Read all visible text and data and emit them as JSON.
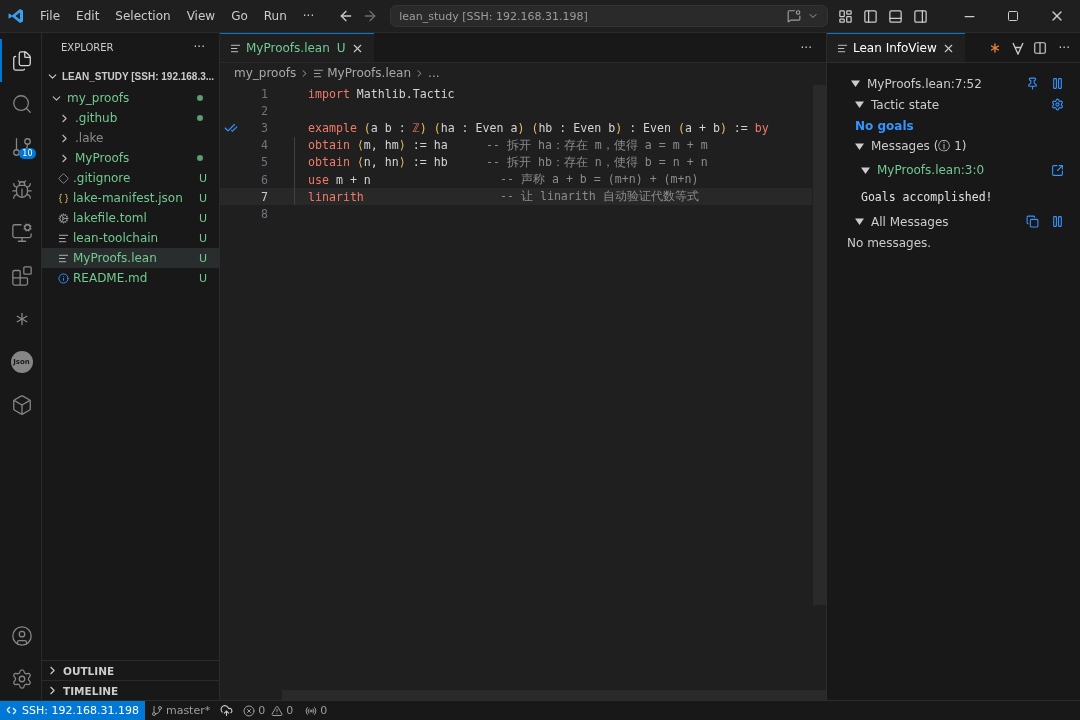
{
  "title_bar": {
    "menu": [
      "File",
      "Edit",
      "Selection",
      "View",
      "Go",
      "Run",
      "···"
    ],
    "search": "lean_study [SSH: 192.168.31.198]"
  },
  "activity_bar": {
    "items": [
      {
        "kind": "explorer",
        "selected": true
      },
      {
        "kind": "search",
        "selected": false
      },
      {
        "kind": "scm",
        "selected": false,
        "badge": "10"
      },
      {
        "kind": "run",
        "selected": false
      },
      {
        "kind": "remote",
        "selected": false
      },
      {
        "kind": "extensions",
        "selected": false
      },
      {
        "kind": "lean",
        "selected": false
      },
      {
        "kind": "json",
        "selected": false,
        "label": "Json"
      },
      {
        "kind": "package",
        "selected": false
      }
    ],
    "bottom": [
      {
        "kind": "account",
        "selected": false
      },
      {
        "kind": "settings",
        "selected": false
      }
    ]
  },
  "sidebar": {
    "title": "EXPLORER",
    "more": "···",
    "root": {
      "label": "LEAN_STUDY [SSH: 192.168.3...",
      "expanded": true
    },
    "tree": [
      {
        "name": "my_proofs",
        "kind": "folder",
        "expanded": true,
        "dot": true,
        "ignored": false,
        "selected": false,
        "children": [
          {
            "name": ".github",
            "kind": "folder",
            "expanded": false,
            "dot": true,
            "ignored": false,
            "selected": false
          },
          {
            "name": ".lake",
            "kind": "folder",
            "expanded": false,
            "dot": false,
            "ignored": true,
            "selected": false
          },
          {
            "name": "MyProofs",
            "kind": "folder",
            "expanded": false,
            "dot": true,
            "ignored": false,
            "selected": false
          },
          {
            "name": ".gitignore",
            "kind": "git",
            "badge": "U",
            "ignored": false,
            "selected": false
          },
          {
            "name": "lake-manifest.json",
            "kind": "json",
            "badge": "U",
            "ignored": false,
            "selected": false
          },
          {
            "name": "lakefile.toml",
            "kind": "toml",
            "badge": "U",
            "ignored": false,
            "selected": false
          },
          {
            "name": "lean-toolchain",
            "kind": "text",
            "badge": "U",
            "ignored": false,
            "selected": false
          },
          {
            "name": "MyProofs.lean",
            "kind": "text",
            "badge": "U",
            "ignored": false,
            "selected": true
          },
          {
            "name": "README.md",
            "kind": "info",
            "badge": "U",
            "ignored": false,
            "selected": false
          }
        ]
      }
    ],
    "sections": [
      {
        "label": "OUTLINE",
        "expanded": false
      },
      {
        "label": "TIMELINE",
        "expanded": false
      }
    ]
  },
  "editor": {
    "tab": {
      "label": "MyProofs.lean",
      "badge": "U",
      "selected": true
    },
    "more": "···",
    "breadcrumbs": [
      "my_proofs",
      "MyProofs.lean",
      "..."
    ],
    "lines": [
      {
        "number": "1",
        "current": false,
        "indent": false,
        "tokens": [
          {
            "kind": "kw",
            "text": "import"
          },
          {
            "kind": "plain",
            "text": " Mathlib.Tactic"
          }
        ]
      },
      {
        "number": "2",
        "current": false,
        "indent": false
      },
      {
        "number": "3",
        "current": false,
        "indent": false,
        "verified": true,
        "tokens": [
          {
            "kind": "kw",
            "text": "example "
          },
          {
            "kind": "br",
            "text": "("
          },
          {
            "kind": "plain",
            "text": "a b : "
          },
          {
            "kind": "kw",
            "text": "ℤ"
          },
          {
            "kind": "br",
            "text": ") ("
          },
          {
            "kind": "plain",
            "text": "ha : Even a"
          },
          {
            "kind": "br",
            "text": ") ("
          },
          {
            "kind": "plain",
            "text": "hb : Even b"
          },
          {
            "kind": "br",
            "text": ")"
          },
          {
            "kind": "plain",
            "text": " : Even "
          },
          {
            "kind": "br",
            "text": "("
          },
          {
            "kind": "plain",
            "text": "a + b"
          },
          {
            "kind": "br",
            "text": ")"
          },
          {
            "kind": "plain",
            "text": " := "
          },
          {
            "kind": "kw",
            "text": "by"
          }
        ]
      },
      {
        "number": "4",
        "current": false,
        "indent": true,
        "tokens": [
          {
            "kind": "kw",
            "text": "obtain "
          },
          {
            "kind": "br",
            "text": "⟨"
          },
          {
            "kind": "plain",
            "text": "m, hm"
          },
          {
            "kind": "br",
            "text": "⟩"
          },
          {
            "kind": "plain",
            "text": " := ha"
          }
        ],
        "comment": "-- 拆开 ha：存在 m，使得 a = m + m"
      },
      {
        "number": "5",
        "current": false,
        "indent": true,
        "tokens": [
          {
            "kind": "kw",
            "text": "obtain "
          },
          {
            "kind": "br",
            "text": "⟨"
          },
          {
            "kind": "plain",
            "text": "n, hn"
          },
          {
            "kind": "br",
            "text": "⟩"
          },
          {
            "kind": "plain",
            "text": " := hb"
          }
        ],
        "comment": "-- 拆开 hb：存在 n，使得 b = n + n"
      },
      {
        "number": "6",
        "current": false,
        "indent": true,
        "tokens": [
          {
            "kind": "kw",
            "text": "use"
          },
          {
            "kind": "plain",
            "text": " m + n"
          }
        ],
        "comment": "-- 声称 a + b = (m+n) + (m+n)"
      },
      {
        "number": "7",
        "current": true,
        "indent": true,
        "tokens": [
          {
            "kind": "kw",
            "text": "linarith"
          }
        ],
        "comment": "-- 让 linarith 自动验证代数等式"
      },
      {
        "number": "8",
        "current": false,
        "indent": false
      }
    ]
  },
  "infoview": {
    "tab": {
      "label": "Lean InfoView",
      "selected": true
    },
    "more": "···",
    "sections": [
      {
        "label": "MyProofs.lean:7:52",
        "kind": "position",
        "expanded": true
      },
      {
        "label": "Tactic state",
        "kind": "tactic_state",
        "expanded": true
      },
      {
        "label": "No goals",
        "kind": "goals"
      },
      {
        "label": "Messages (ⓘ 1)",
        "kind": "heading",
        "expanded": true
      },
      {
        "label": "MyProofs.lean:3:0",
        "kind": "location",
        "expanded": true
      },
      {
        "label": "Goals accomplished!",
        "kind": "message"
      },
      {
        "label": "All Messages",
        "kind": "all_messages",
        "expanded": true
      },
      {
        "label": "No messages.",
        "kind": "note"
      }
    ]
  },
  "status_bar": {
    "remote": "SSH: 192.168.31.198",
    "branch": "master*",
    "errors": "0",
    "warnings": "0",
    "ports": "0"
  }
}
